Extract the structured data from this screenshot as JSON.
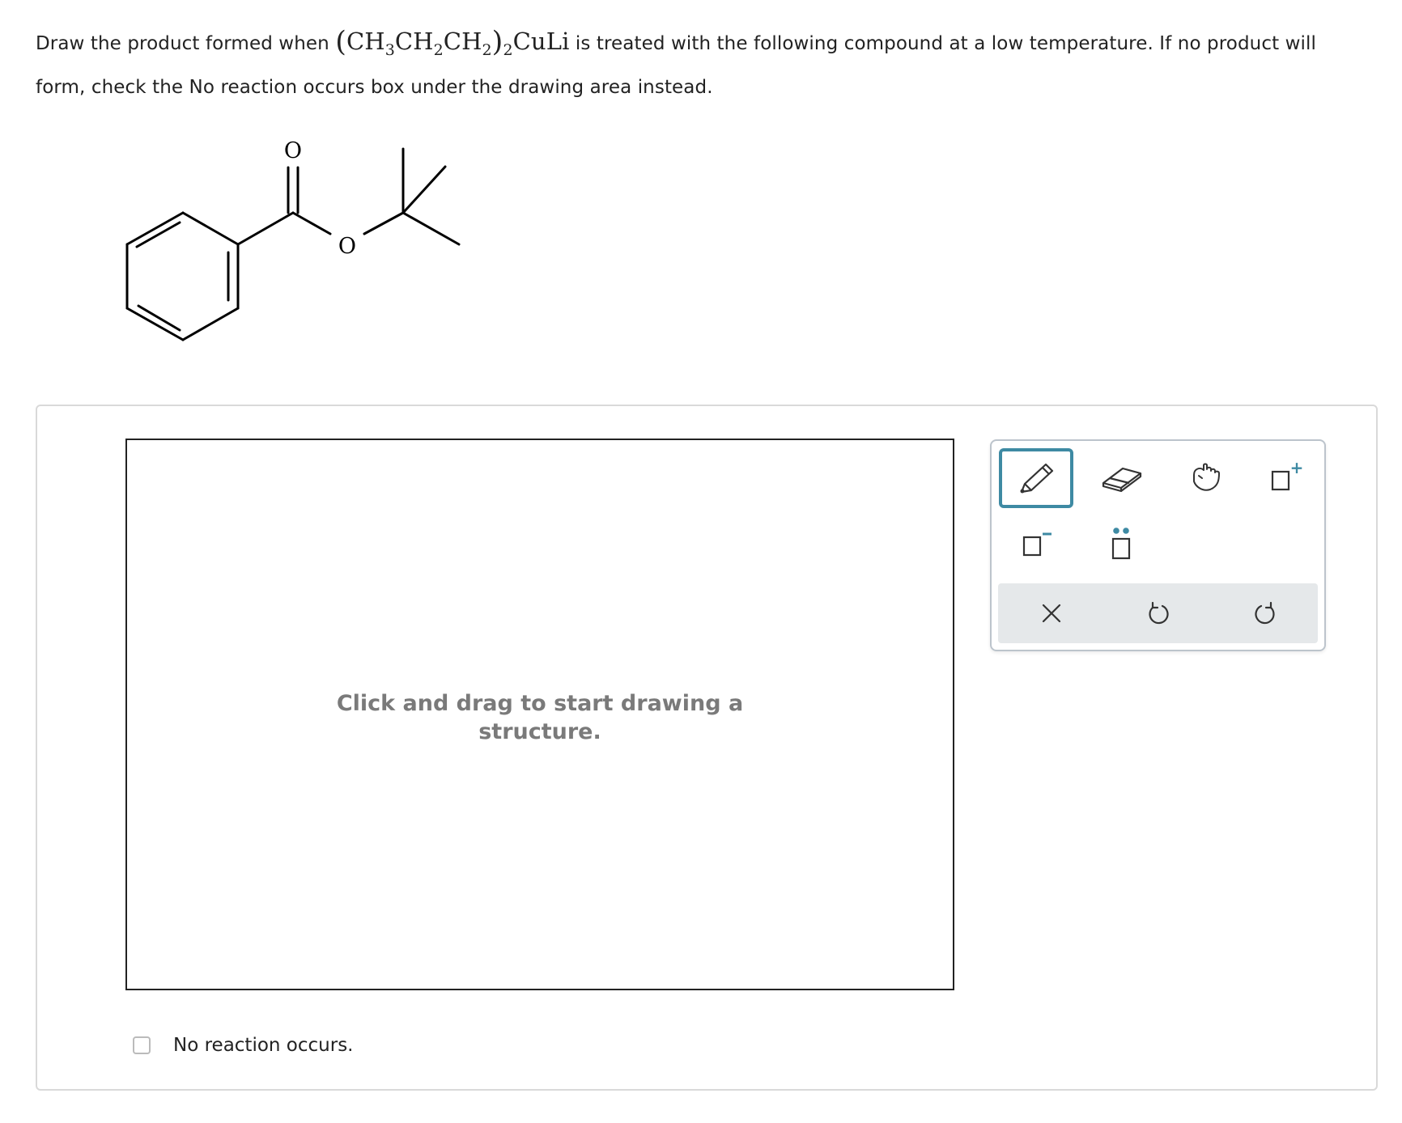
{
  "question": {
    "text_before": "Draw the product formed when ",
    "formula": {
      "paren_open": "(",
      "ch3": "CH",
      "sub3": "3",
      "ch2a": "CH",
      "sub2a": "2",
      "ch2b": "CH",
      "sub2b": "2",
      "paren_close": ")",
      "sub_outer": "2",
      "culi": "CuLi"
    },
    "text_after": " is treated with the following compound at a low temperature. If no product will form, check the No reaction occurs box under the drawing area instead."
  },
  "reactant": {
    "carbonyl_o": "O",
    "ester_o": "O"
  },
  "drawing_area": {
    "hint_line1": "Click and drag to start drawing a",
    "hint_line2": "structure."
  },
  "toolbar": {
    "tools": [
      "pencil-icon",
      "eraser-icon",
      "hand-icon",
      "positive-charge-icon",
      "negative-charge-icon",
      "lone-pair-icon"
    ],
    "actions": [
      "clear-icon",
      "undo-icon",
      "redo-icon"
    ],
    "active_tool": "pencil-icon",
    "positive_symbol": "+",
    "accent_color": "#3e8aa3"
  },
  "no_reaction": {
    "label": "No reaction occurs.",
    "checked": false
  }
}
